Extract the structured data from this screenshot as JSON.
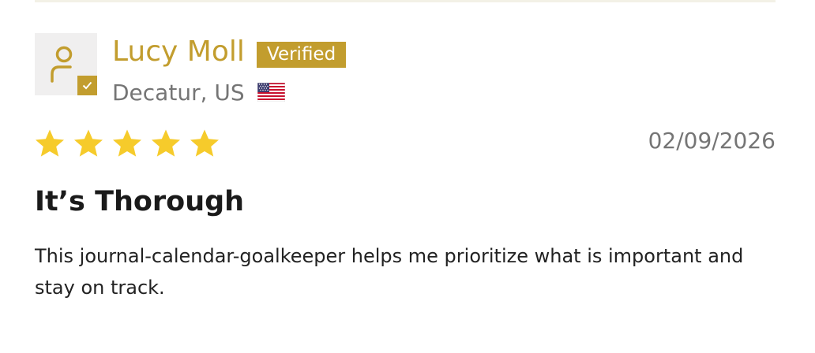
{
  "review": {
    "reviewer": {
      "name": "Lucy Moll",
      "verified_label": "Verified",
      "location": "Decatur, US",
      "country_flag_icon": "us-flag-icon",
      "avatar_icon": "user-icon"
    },
    "rating": {
      "value": 5,
      "max": 5
    },
    "date": "02/09/2026",
    "title": "It’s Thorough",
    "body": "This journal-calendar-goalkeeper helps me prioritize what is important and stay on track."
  },
  "colors": {
    "accent": "#c29d2e",
    "star": "#f6cb2b",
    "muted_text": "#757575",
    "title_text": "#1a1a1a",
    "avatar_bg": "#f0efef"
  }
}
